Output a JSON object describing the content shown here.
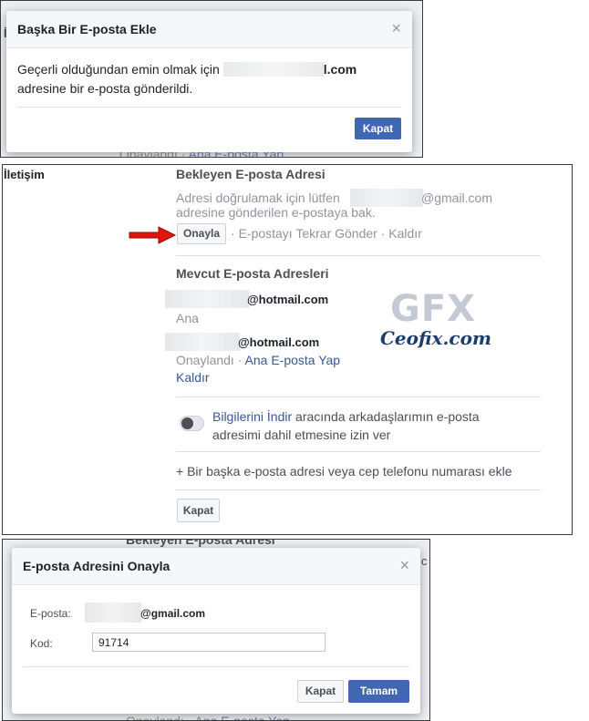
{
  "panel1": {
    "under_text": "Onaylandı · ",
    "under_link": "Ana E-posta Yap",
    "left_text": "İ",
    "dialog": {
      "title": "Başka Bir E-posta Ekle",
      "close_glyph": "×",
      "message_before": "Geçerli olduğundan emin olmak için ",
      "email_suffix": "l.com",
      "message_after": "adresine bir e-posta gönderildi.",
      "close_button": "Kapat"
    }
  },
  "panel2": {
    "section_label": "İletişim",
    "pending": {
      "title": "Bekleyen E-posta Adresi",
      "line1_before": "Adresi doğrulamak için lütfen",
      "line1_email_suffix": "@gmail.com",
      "line2": "adresine gönderilen e-postaya bak.",
      "confirm_button": "Onayla",
      "resend": "E-postayı Tekrar Gönder",
      "remove": "Kaldır",
      "separator": "·"
    },
    "current": {
      "title": "Mevcut E-posta Adresleri",
      "email1_suffix": "@hotmail.com",
      "email1_status": "Ana",
      "email2_suffix": "@hotmail.com",
      "email2_status": "Onaylandı",
      "email2_make_primary": "Ana E-posta Yap",
      "email2_remove": "Kaldır"
    },
    "watermark": {
      "logo": "GFX",
      "text": "Ceofix.com"
    },
    "download": {
      "link": "Bilgilerini İndir",
      "text_rest": " aracında arkadaşlarımın e-posta",
      "text_line2": "adresimi dahil etmesine izin ver",
      "toggle_on": false
    },
    "add_another": "+ Bir başka e-posta adresi veya cep telefonu numarası ekle",
    "close_button": "Kapat",
    "arrow_color": "#e3140f"
  },
  "panel3": {
    "ghost_top": "Bekleyen E-posta Adresi",
    "ghost_bottom_before": "Onaylandı · ",
    "ghost_bottom_link": "Ana E-posta Yap",
    "ghost_right": "c",
    "dialog": {
      "title": "E-posta Adresini Onayla",
      "close_glyph": "×",
      "email_label": "E-posta:",
      "email_suffix": "@gmail.com",
      "code_label": "Kod:",
      "code_value": "91714",
      "cancel_button": "Kapat",
      "ok_button": "Tamam"
    }
  }
}
